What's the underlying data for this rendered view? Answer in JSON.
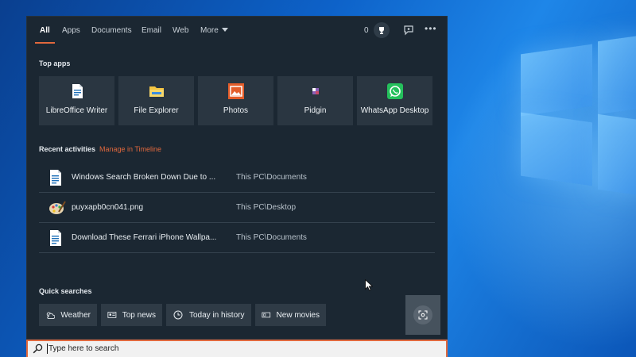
{
  "tabs": [
    {
      "label": "All"
    },
    {
      "label": "Apps"
    },
    {
      "label": "Documents"
    },
    {
      "label": "Email"
    },
    {
      "label": "Web"
    },
    {
      "label": "More"
    }
  ],
  "header": {
    "rewards_count": "0",
    "icons": [
      "trophy-icon",
      "feedback-icon",
      "more-options-icon"
    ]
  },
  "top_apps": {
    "title": "Top apps",
    "items": [
      {
        "label": "LibreOffice Writer",
        "icon": "libreoffice-writer-icon"
      },
      {
        "label": "File Explorer",
        "icon": "folder-icon"
      },
      {
        "label": "Photos",
        "icon": "photos-icon"
      },
      {
        "label": "Pidgin",
        "icon": "pidgin-icon"
      },
      {
        "label": "WhatsApp Desktop",
        "icon": "whatsapp-icon"
      }
    ]
  },
  "recent": {
    "title": "Recent activities",
    "manage_link": "Manage in Timeline",
    "items": [
      {
        "name": "Windows Search Broken Down Due to ...",
        "path": "This PC\\Documents",
        "icon": "document-icon"
      },
      {
        "name": "puyxapb0cn041.png",
        "path": "This PC\\Desktop",
        "icon": "paint-palette-icon"
      },
      {
        "name": "Download These Ferrari iPhone Wallpa...",
        "path": "This PC\\Documents",
        "icon": "document-icon"
      }
    ]
  },
  "quick_searches": {
    "title": "Quick searches",
    "items": [
      {
        "label": "Weather",
        "icon": "weather-icon"
      },
      {
        "label": "Top news",
        "icon": "news-icon"
      },
      {
        "label": "Today in history",
        "icon": "clock-icon"
      },
      {
        "label": "New movies",
        "icon": "movie-icon"
      }
    ]
  },
  "search": {
    "placeholder": "Type here to search"
  },
  "colors": {
    "accent": "#e0683d",
    "panel": "#1b2732",
    "tile": "#2a3641"
  }
}
